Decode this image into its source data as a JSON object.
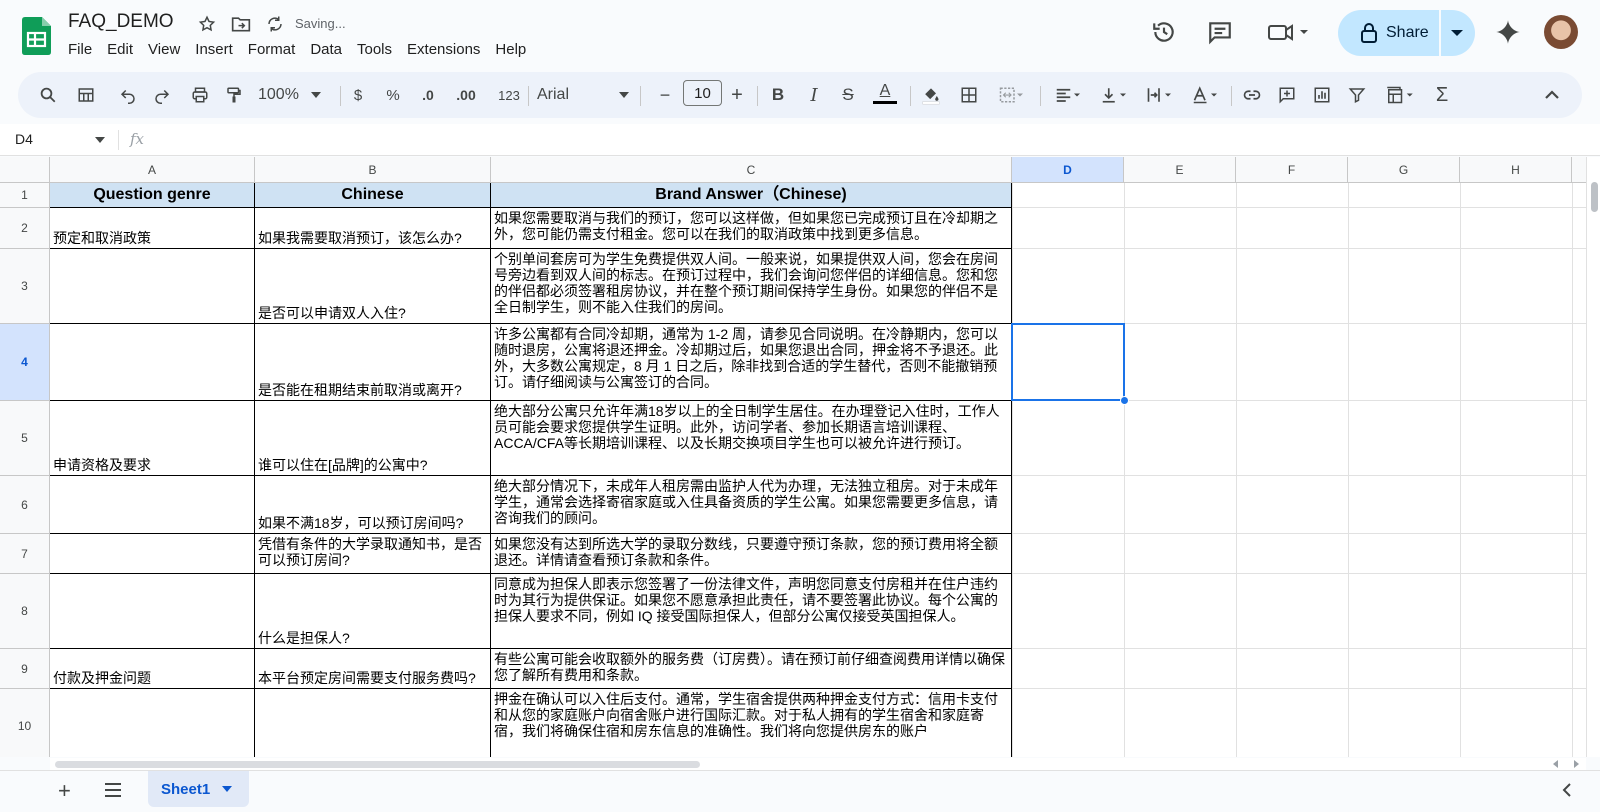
{
  "doc": {
    "title": "FAQ_DEMO",
    "status": "Saving..."
  },
  "menu": [
    "File",
    "Edit",
    "View",
    "Insert",
    "Format",
    "Data",
    "Tools",
    "Extensions",
    "Help"
  ],
  "share": {
    "label": "Share"
  },
  "toolbar": {
    "zoom": "100%",
    "currency": "$",
    "percent": "%",
    "dec_decrease": ".0",
    "dec_increase": ".00",
    "number_format": "123",
    "font": "Arial",
    "font_size": "10",
    "minus": "−",
    "plus": "+",
    "bold": "B",
    "italic": "I",
    "strike": "S",
    "text_color": "A",
    "sigma": "Σ"
  },
  "formula_bar": {
    "cell_ref": "D4",
    "fx": "fx",
    "value": ""
  },
  "columns": [
    "A",
    "B",
    "C",
    "D",
    "E",
    "F",
    "G",
    "H"
  ],
  "rows": [
    "1",
    "2",
    "3",
    "4",
    "5",
    "6",
    "7",
    "8",
    "9",
    "10"
  ],
  "header_row": {
    "a": "Question genre",
    "b": "Chinese",
    "c": "Brand Answer（Chinese)"
  },
  "data_rows": [
    {
      "a": "预定和取消政策",
      "b": "如果我需要取消预订，该怎么办?",
      "c": "如果您需要取消与我们的预订，您可以这样做，但如果您已完成预订且在冷却期之外，您可能仍需支付租金。您可以在我们的取消政策中找到更多信息。"
    },
    {
      "a": "",
      "b": "是否可以申请双人入住?",
      "c": "个别单间套房可为学生免费提供双人间。一般来说，如果提供双人间，您会在房间号旁边看到双人间的标志。在预订过程中，我们会询问您伴侣的详细信息。您和您的伴侣都必须签署租房协议，并在整个预订期间保持学生身份。如果您的伴侣不是全日制学生，则不能入住我们的房间。"
    },
    {
      "a": "",
      "b": "是否能在租期结束前取消或离开?",
      "c": "许多公寓都有合同冷却期，通常为 1-2 周，请参见合同说明。在冷静期内，您可以随时退房，公寓将退还押金。冷却期过后，如果您退出合同，押金将不予退还。此外，大多数公寓规定，8 月 1 日之后，除非找到合适的学生替代，否则不能撤销预订。请仔细阅读与公寓签订的合同。"
    },
    {
      "a": "申请资格及要求",
      "b": "谁可以住在[品牌]的公寓中?",
      "c": "绝大部分公寓只允许年满18岁以上的全日制学生居住。在办理登记入住时，工作人员可能会要求您提供学生证明。此外，访问学者、参加长期语言培训课程、ACCA/CFA等长期培训课程、以及长期交换项目学生也可以被允许进行预订。"
    },
    {
      "a": "",
      "b": "如果不满18岁，可以预订房间吗?",
      "c": "绝大部分情况下，未成年人租房需由监护人代为办理，无法独立租房。对于未成年学生，通常会选择寄宿家庭或入住具备资质的学生公寓。如果您需要更多信息，请咨询我们的顾问。"
    },
    {
      "a": "",
      "b": "凭借有条件的大学录取通知书，是否可以预订房间?",
      "c": "如果您没有达到所选大学的录取分数线，只要遵守预订条款，您的预订费用将全额退还。详情请查看预订条款和条件。"
    },
    {
      "a": "",
      "b": "什么是担保人?",
      "c": "同意成为担保人即表示您签署了一份法律文件，声明您同意支付房租并在住户违约时为其行为提供保证。如果您不愿意承担此责任，请不要签署此协议。每个公寓的担保人要求不同，例如 IQ 接受国际担保人，但部分公寓仅接受英国担保人。"
    },
    {
      "a": "付款及押金问题",
      "b": "本平台预定房间需要支付服务费吗?",
      "c": "有些公寓可能会收取额外的服务费（订房费）。请在预订前仔细查阅费用详情以确保您了解所有费用和条款。"
    },
    {
      "a": "",
      "b": "",
      "c": "押金在确认可以入住后支付。通常，学生宿舍提供两种押金支付方式：信用卡支付和从您的家庭账户向宿舍账户进行国际汇款。对于私人拥有的学生宿舍和家庭寄宿，我们将确保住宿和房东信息的准确性。我们将向您提供房东的账户"
    }
  ],
  "sheet_tab": {
    "label": "Sheet1"
  },
  "colors": {
    "accent": "#1a73e8",
    "header_fill": "#cfe2f3",
    "share_bg": "#c2e7ff",
    "sheets_green": "#0f9d58"
  }
}
